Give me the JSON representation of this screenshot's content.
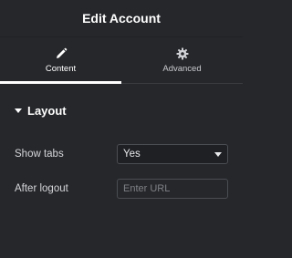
{
  "header": {
    "title": "Edit Account"
  },
  "tabs": [
    {
      "label": "Content",
      "icon": "pencil-icon",
      "active": true
    },
    {
      "label": "Advanced",
      "icon": "gear-icon",
      "active": false
    }
  ],
  "section": {
    "title": "Layout",
    "icon": "caret-down-icon"
  },
  "controls": {
    "show_tabs": {
      "label": "Show tabs",
      "value": "Yes"
    },
    "after_logout": {
      "label": "After logout",
      "value": "",
      "placeholder": "Enter URL"
    }
  },
  "colors": {
    "background": "#26272b",
    "active_tab_indicator": "#ffffff",
    "input_border": "#4a4d52"
  }
}
